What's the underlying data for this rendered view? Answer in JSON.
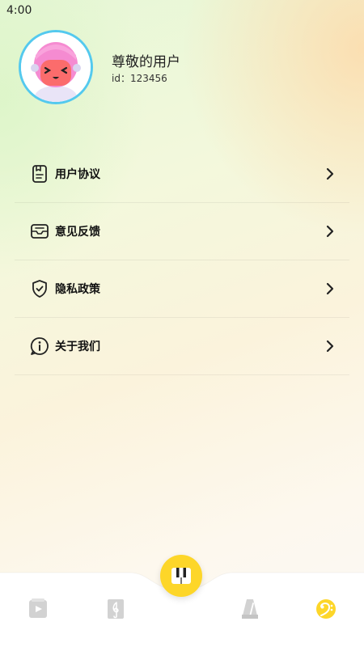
{
  "status_bar": {
    "time": "4:00"
  },
  "profile": {
    "name": "尊敬的用户",
    "id_text": "id：123456",
    "avatar_icon": "astronaut-avatar"
  },
  "menu": {
    "items": [
      {
        "label": "用户协议",
        "icon": "document-icon"
      },
      {
        "label": "意见反馈",
        "icon": "mail-icon"
      },
      {
        "label": "隐私政策",
        "icon": "shield-check-icon"
      },
      {
        "label": "关于我们",
        "icon": "info-icon"
      }
    ]
  },
  "tabbar": {
    "items": [
      {
        "icon": "video-book-icon",
        "active": false
      },
      {
        "icon": "music-score-icon",
        "active": false
      },
      {
        "icon": "piano-keys-icon",
        "active": true,
        "center": true
      },
      {
        "icon": "metronome-icon",
        "active": false
      },
      {
        "icon": "bass-clef-icon",
        "active": true
      }
    ],
    "accent_color": "#fdd629",
    "inactive_color": "#c8c8c8"
  }
}
